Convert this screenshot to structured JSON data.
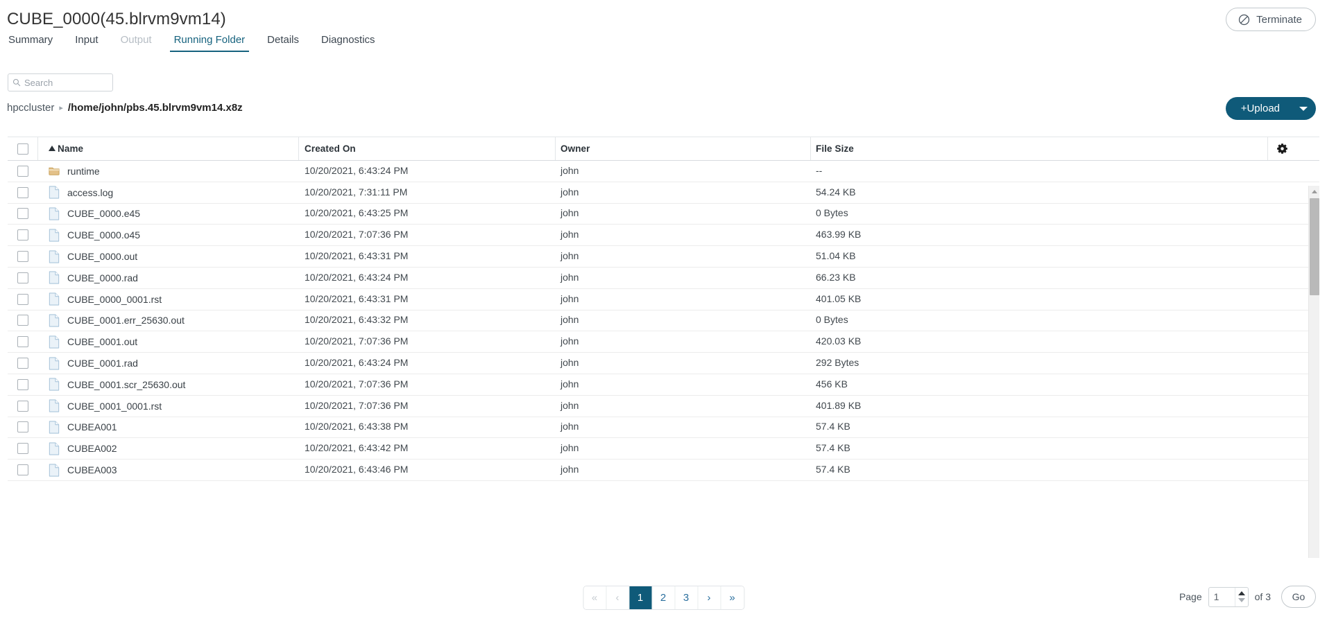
{
  "header": {
    "title": "CUBE_0000(45.blrvm9vm14)",
    "terminate_label": "Terminate",
    "terminate_icon": "ban-icon"
  },
  "tabs": [
    {
      "label": "Summary",
      "state": "normal"
    },
    {
      "label": "Input",
      "state": "normal"
    },
    {
      "label": "Output",
      "state": "disabled"
    },
    {
      "label": "Running Folder",
      "state": "active"
    },
    {
      "label": "Details",
      "state": "normal"
    },
    {
      "label": "Diagnostics",
      "state": "normal"
    }
  ],
  "search": {
    "placeholder": "Search",
    "value": "",
    "icon": "search-icon"
  },
  "breadcrumb": {
    "root": "hpccluster",
    "separator": "▸",
    "path": "/home/john/pbs.45.blrvm9vm14.x8z"
  },
  "upload": {
    "label": "+Upload",
    "caret_icon": "chevron-down-icon"
  },
  "table": {
    "columns": [
      {
        "key": "name",
        "label": "Name",
        "sort": "asc"
      },
      {
        "key": "date",
        "label": "Created On",
        "sort": ""
      },
      {
        "key": "owner",
        "label": "Owner",
        "sort": ""
      },
      {
        "key": "size",
        "label": "File Size",
        "sort": ""
      }
    ],
    "settings_icon": "gear-icon",
    "rows": [
      {
        "type": "folder",
        "name": "runtime",
        "date": "10/20/2021, 6:43:24 PM",
        "owner": "john",
        "size": "--"
      },
      {
        "type": "file",
        "name": "access.log",
        "date": "10/20/2021, 7:31:11 PM",
        "owner": "john",
        "size": "54.24 KB"
      },
      {
        "type": "file",
        "name": "CUBE_0000.e45",
        "date": "10/20/2021, 6:43:25 PM",
        "owner": "john",
        "size": "0 Bytes"
      },
      {
        "type": "file",
        "name": "CUBE_0000.o45",
        "date": "10/20/2021, 7:07:36 PM",
        "owner": "john",
        "size": "463.99 KB"
      },
      {
        "type": "file",
        "name": "CUBE_0000.out",
        "date": "10/20/2021, 6:43:31 PM",
        "owner": "john",
        "size": "51.04 KB"
      },
      {
        "type": "file",
        "name": "CUBE_0000.rad",
        "date": "10/20/2021, 6:43:24 PM",
        "owner": "john",
        "size": "66.23 KB"
      },
      {
        "type": "file",
        "name": "CUBE_0000_0001.rst",
        "date": "10/20/2021, 6:43:31 PM",
        "owner": "john",
        "size": "401.05 KB"
      },
      {
        "type": "file",
        "name": "CUBE_0001.err_25630.out",
        "date": "10/20/2021, 6:43:32 PM",
        "owner": "john",
        "size": "0 Bytes"
      },
      {
        "type": "file",
        "name": "CUBE_0001.out",
        "date": "10/20/2021, 7:07:36 PM",
        "owner": "john",
        "size": "420.03 KB"
      },
      {
        "type": "file",
        "name": "CUBE_0001.rad",
        "date": "10/20/2021, 6:43:24 PM",
        "owner": "john",
        "size": "292 Bytes"
      },
      {
        "type": "file",
        "name": "CUBE_0001.scr_25630.out",
        "date": "10/20/2021, 7:07:36 PM",
        "owner": "john",
        "size": "456 KB"
      },
      {
        "type": "file",
        "name": "CUBE_0001_0001.rst",
        "date": "10/20/2021, 7:07:36 PM",
        "owner": "john",
        "size": "401.89 KB"
      },
      {
        "type": "file",
        "name": "CUBEA001",
        "date": "10/20/2021, 6:43:38 PM",
        "owner": "john",
        "size": "57.4 KB"
      },
      {
        "type": "file",
        "name": "CUBEA002",
        "date": "10/20/2021, 6:43:42 PM",
        "owner": "john",
        "size": "57.4 KB"
      },
      {
        "type": "file",
        "name": "CUBEA003",
        "date": "10/20/2021, 6:43:46 PM",
        "owner": "john",
        "size": "57.4 KB"
      }
    ]
  },
  "pagination": {
    "first_label": "«",
    "prev_label": "‹",
    "pages": [
      "1",
      "2",
      "3"
    ],
    "active_page": "1",
    "next_label": "›",
    "last_label": "»",
    "page_label": "Page",
    "page_value": "1",
    "of_label": "of 3",
    "go_label": "Go"
  },
  "colors": {
    "accent": "#0f5a79",
    "active_tab": "#16627e",
    "link": "#2a6f9e",
    "folder": "#d9b779",
    "file": "#cfe0ee"
  }
}
